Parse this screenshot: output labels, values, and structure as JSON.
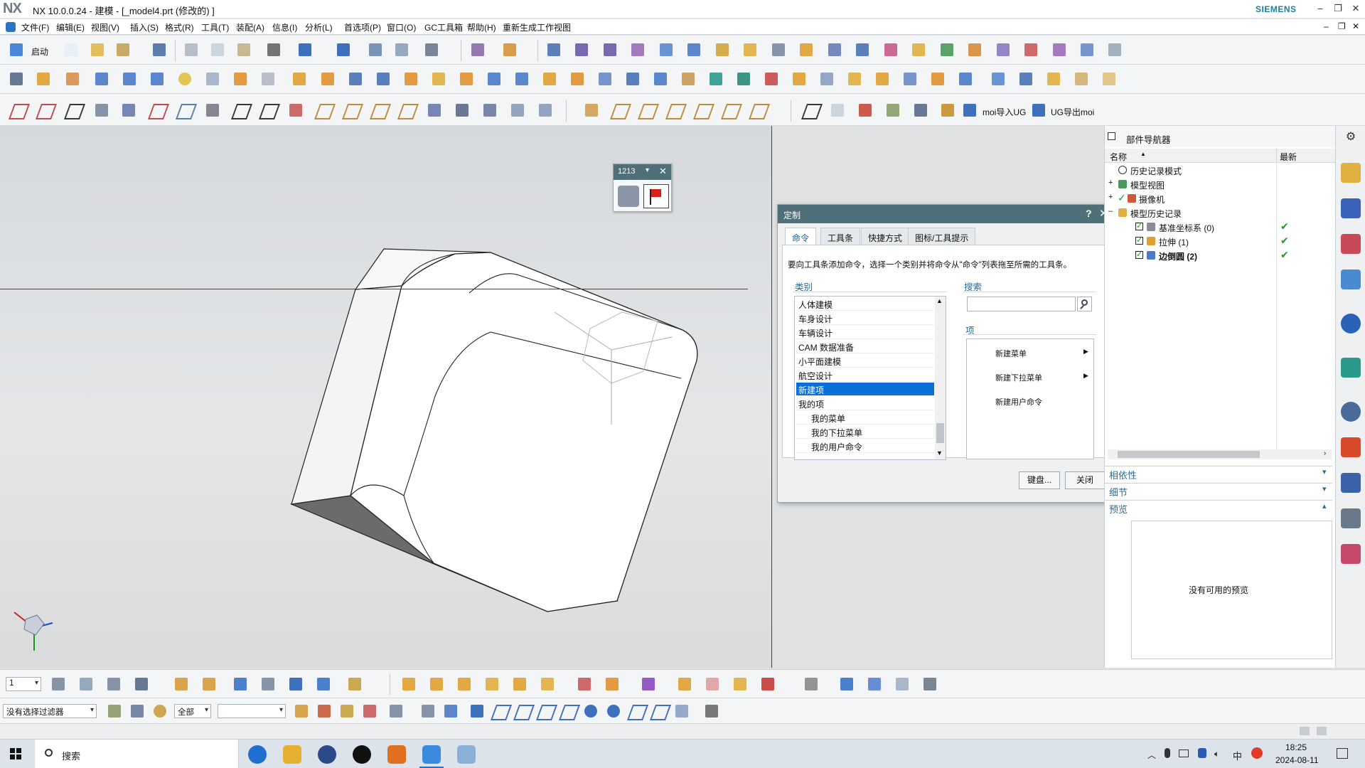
{
  "window": {
    "app_logo": "NX",
    "title": "NX 10.0.0.24 - 建模 - [_model4.prt  (修改的) ]",
    "brand": "SIEMENS",
    "controls": [
      "–",
      "❐",
      "✕"
    ],
    "inner_controls": [
      "–",
      "❐",
      "✕"
    ]
  },
  "menubar": {
    "items": [
      "文件(F)",
      "编辑(E)",
      "视图(V)",
      "插入(S)",
      "格式(R)",
      "工具(T)",
      "装配(A)",
      "信息(I)",
      "分析(L)",
      "首选项(P)",
      "窗口(O)",
      "GC工具箱",
      "帮助(H)",
      "重新生成工作视图"
    ]
  },
  "toolbar1": {
    "start_label": "启动"
  },
  "toolbar3": {
    "moi_import": "moi导入UG",
    "moi_export": "UG导出moi"
  },
  "mini_popup": {
    "title": "1213",
    "icons": [
      "binoculars-icon",
      "red-flag-icon"
    ]
  },
  "dialog": {
    "title": "定制",
    "help": "?",
    "close": "✕",
    "tabs": [
      "命令",
      "工具条",
      "快捷方式",
      "图标/工具提示"
    ],
    "active_tab": "命令",
    "description": "要向工具条添加命令，选择一个类别并将命令从\"命令\"列表拖至所需的工具条。",
    "category_label": "类别",
    "categories": [
      "人体建模",
      "车身设计",
      "车辆设计",
      "CAM 数据准备",
      "小平面建模",
      "航空设计",
      "新建项",
      "我的项",
      "我的菜单",
      "我的下拉菜单",
      "我的用户命令"
    ],
    "selected_category": "新建项",
    "search_label": "搜索",
    "search_value": "",
    "items_label": "项",
    "items": [
      "新建菜单",
      "新建下拉菜单",
      "新建用户命令"
    ],
    "keyboard_button": "键盘...",
    "close_button": "关闭"
  },
  "navigator": {
    "title": "部件导航器",
    "col_name": "名称",
    "col_latest": "最新",
    "sort_indicator": "▲",
    "nodes": [
      {
        "label": "历史记录模式"
      },
      {
        "label": "模型视图"
      },
      {
        "label": "摄像机"
      },
      {
        "label": "模型历史记录"
      },
      {
        "label": "基准坐标系 (0)",
        "latest": "✔"
      },
      {
        "label": "拉伸 (1)",
        "latest": "✔"
      },
      {
        "label": "边倒圆 (2)",
        "latest": "✔"
      }
    ],
    "sections": [
      "相依性",
      "细节",
      "预览"
    ],
    "preview_text": "没有可用的预览"
  },
  "bottom": {
    "layer_value": "1",
    "filter_value": "没有选择过滤器",
    "scope_value": "全部",
    "blank_combo": ""
  },
  "taskbar": {
    "search_placeholder": "搜索",
    "time": "18:25",
    "date": "2024-08-11",
    "ime": "中"
  },
  "colors": {
    "dialog_header": "#4f6f79",
    "selection": "#0a6fd8",
    "accent_text": "#2a6b93",
    "check_green": "#1aa01a"
  }
}
